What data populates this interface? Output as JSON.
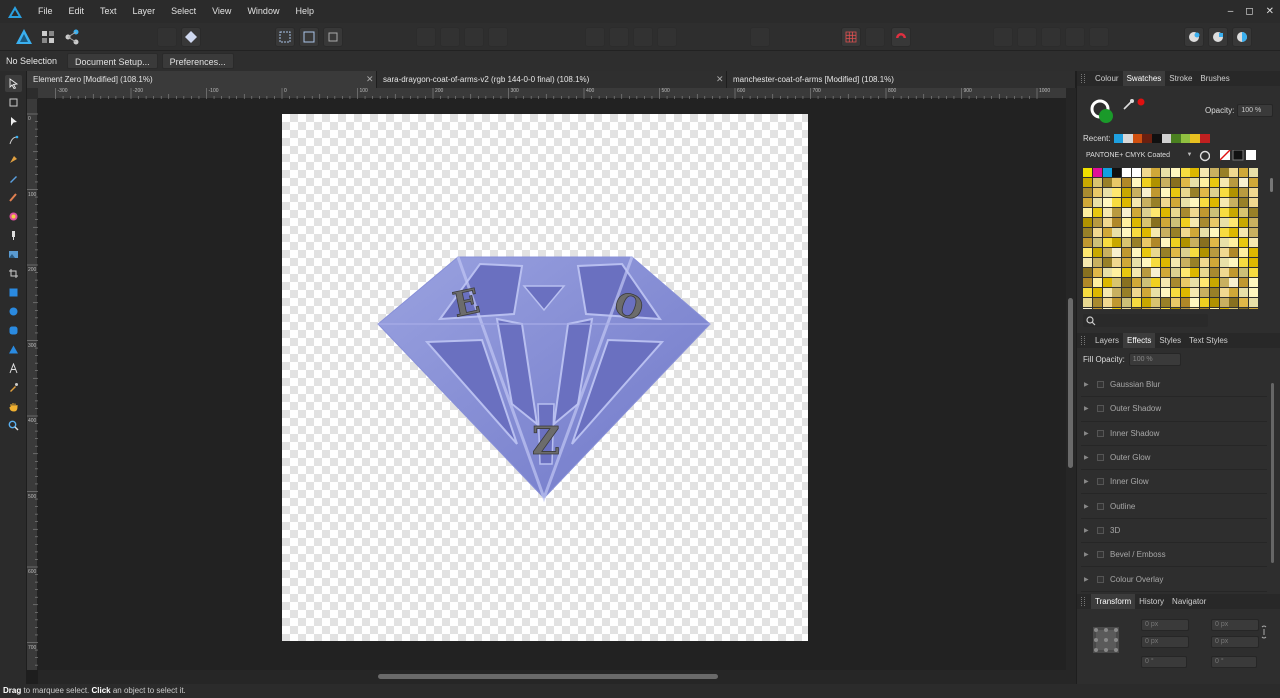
{
  "menu": [
    "File",
    "Edit",
    "Text",
    "Layer",
    "Select",
    "View",
    "Window",
    "Help"
  ],
  "window_controls": [
    "–",
    "◻",
    "✕"
  ],
  "context": {
    "selection": "No Selection",
    "document_setup": "Document Setup...",
    "preferences": "Preferences..."
  },
  "tabs": [
    {
      "label": "Element Zero [Modified] (108.1%)"
    },
    {
      "label": "sara-draygon-coat-of-arms-v2 (rgb 144-0-0 final) (108.1%)"
    },
    {
      "label": "manchester-coat-of-arms [Modified] (108.1%)"
    }
  ],
  "tab_close": "✕",
  "ruler_h": [
    "-300",
    "-200",
    "-100",
    "0",
    "100",
    "200",
    "300",
    "400",
    "500",
    "600",
    "700",
    "800",
    "900",
    "1000"
  ],
  "ruler_v": [
    "0",
    "100",
    "200",
    "300",
    "400",
    "500",
    "600",
    "700",
    "800"
  ],
  "canvas": {
    "letters": [
      "E",
      "O",
      "Z"
    ]
  },
  "status": {
    "drag": "Drag",
    "part1": " to marquee select. ",
    "click": "Click",
    "part2": " an object to select it."
  },
  "colour_panel": {
    "tabs": [
      "Colour",
      "Swatches",
      "Stroke",
      "Brushes"
    ],
    "active_tab": "Swatches",
    "opacity_label": "Opacity:",
    "opacity_value": "100 %",
    "recent_label": "Recent:",
    "recent_colors": [
      "#1ea0e0",
      "#d8d8d8",
      "#d05010",
      "#6a2010",
      "#101010",
      "#d0d0d0",
      "#4a8020",
      "#90c040",
      "#e8c020",
      "#c02020"
    ],
    "palette_name": "PANTONE+ CMYK Coated",
    "fill_color": "#1a9a2a",
    "stroke_color": "#ffffff",
    "accent_red": "#e01010"
  },
  "effects_panel": {
    "tabs": [
      "Layers",
      "Effects",
      "Styles",
      "Text Styles"
    ],
    "active_tab": "Effects",
    "fill_opacity_label": "Fill Opacity:",
    "fill_opacity_value": "100 %",
    "effects": [
      "Gaussian Blur",
      "Outer Shadow",
      "Inner Shadow",
      "Outer Glow",
      "Inner Glow",
      "Outline",
      "3D",
      "Bevel / Emboss",
      "Colour Overlay"
    ]
  },
  "transform_panel": {
    "tabs": [
      "Transform",
      "History",
      "Navigator"
    ],
    "active_tab": "Transform",
    "x": "0 px",
    "y": "0 px",
    "w": "0 px",
    "h": "0 px",
    "r": "0 °",
    "s": "0 °"
  }
}
